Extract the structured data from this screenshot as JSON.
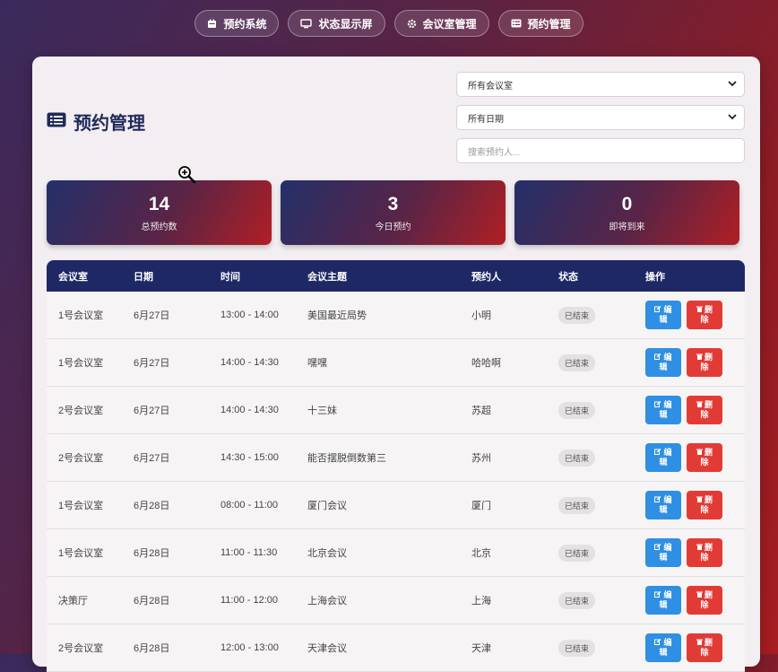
{
  "nav": [
    {
      "label": "预约系统",
      "icon": "calendar-icon"
    },
    {
      "label": "状态显示屏",
      "icon": "monitor-icon"
    },
    {
      "label": "会议室管理",
      "icon": "gear-icon"
    },
    {
      "label": "预约管理",
      "icon": "list-icon"
    }
  ],
  "page": {
    "title": "预约管理",
    "icon": "list-icon"
  },
  "filters": {
    "room": "所有会议室",
    "date": "所有日期",
    "search_placeholder": "搜索预约人..."
  },
  "stats": [
    {
      "value": "14",
      "label": "总预约数"
    },
    {
      "value": "3",
      "label": "今日预约"
    },
    {
      "value": "0",
      "label": "即将到来"
    }
  ],
  "table": {
    "headers": [
      "会议室",
      "日期",
      "时间",
      "会议主题",
      "预约人",
      "状态",
      "操作"
    ],
    "edit_label": [
      "编",
      "辑"
    ],
    "delete_label": [
      "删",
      "除"
    ],
    "rows": [
      {
        "room": "1号会议室",
        "date": "6月27日",
        "time": "13:00 - 14:00",
        "topic": "美国最近局势",
        "booker": "小明",
        "status": "已结束"
      },
      {
        "room": "1号会议室",
        "date": "6月27日",
        "time": "14:00 - 14:30",
        "topic": "嘿嘿",
        "booker": "哈哈啊",
        "status": "已结束"
      },
      {
        "room": "2号会议室",
        "date": "6月27日",
        "time": "14:00 - 14:30",
        "topic": "十三妹",
        "booker": "苏超",
        "status": "已结束"
      },
      {
        "room": "2号会议室",
        "date": "6月27日",
        "time": "14:30 - 15:00",
        "topic": "能否摆脱倒数第三",
        "booker": "苏州",
        "status": "已结束"
      },
      {
        "room": "1号会议室",
        "date": "6月28日",
        "time": "08:00 - 11:00",
        "topic": "厦门会议",
        "booker": "厦门",
        "status": "已结束"
      },
      {
        "room": "1号会议室",
        "date": "6月28日",
        "time": "11:00 - 11:30",
        "topic": "北京会议",
        "booker": "北京",
        "status": "已结束"
      },
      {
        "room": "决策厅",
        "date": "6月28日",
        "time": "11:00 - 12:00",
        "topic": "上海会议",
        "booker": "上海",
        "status": "已结束"
      },
      {
        "room": "2号会议室",
        "date": "6月28日",
        "time": "12:00 - 13:00",
        "topic": "天津会议",
        "booker": "天津",
        "status": "已结束"
      }
    ]
  }
}
